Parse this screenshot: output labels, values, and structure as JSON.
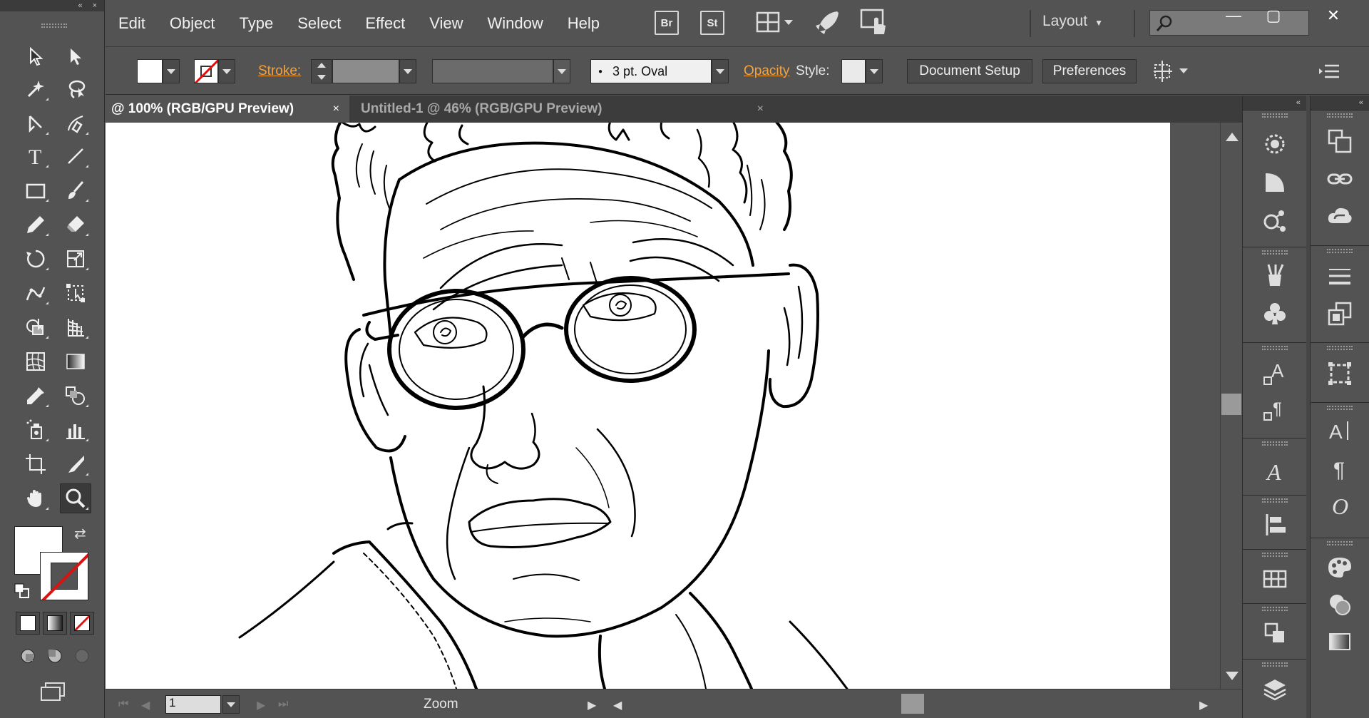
{
  "menubar": {
    "items": [
      "Edit",
      "Object",
      "Type",
      "Select",
      "Effect",
      "View",
      "Window",
      "Help"
    ],
    "bridge_label": "Br",
    "stock_label": "St",
    "workspace_label": "Layout",
    "search_placeholder": ""
  },
  "window_controls": {
    "minimize": "—",
    "maximize": "▢",
    "close": "✕"
  },
  "control_bar": {
    "stroke_label": "Stroke:",
    "brush_value": "3 pt. Oval",
    "opacity_label": "Opacity",
    "style_label": "Style:",
    "document_setup": "Document Setup",
    "preferences": "Preferences"
  },
  "tabs": [
    {
      "label": "@ 100% (RGB/GPU Preview)",
      "close": "×",
      "active": true
    },
    {
      "label": "Untitled-1 @ 46% (RGB/GPU Preview)",
      "close": "×",
      "active": false
    }
  ],
  "toolbox": {
    "header_collapse": "«",
    "header_close": "×",
    "tools": [
      "selection-tool",
      "direct-selection-tool",
      "magic-wand-tool",
      "lasso-tool",
      "pen-tool",
      "curvature-tool",
      "type-tool",
      "line-segment-tool",
      "rectangle-tool",
      "paintbrush-tool",
      "pencil-tool",
      "eraser-tool",
      "rotate-tool",
      "scale-tool",
      "puppet-warp-tool",
      "free-transform-tool",
      "shape-builder-tool",
      "perspective-grid-tool",
      "mesh-tool",
      "gradient-tool",
      "eyedropper-tool",
      "blend-tool",
      "symbol-sprayer-tool",
      "column-graph-tool",
      "artboard-tool",
      "slice-tool",
      "hand-tool",
      "zoom-tool"
    ],
    "active_tool": "zoom-tool"
  },
  "status_bar": {
    "page_number": "1",
    "status_text": "Zoom"
  },
  "panel_headers": {
    "dock1_collapse": "«",
    "dock2_collapse": "«"
  },
  "colors": {
    "ui_bg": "#535353",
    "ui_dark": "#3c3c3c",
    "accent_orange": "#f7a23a",
    "none_red": "#e01010",
    "canvas": "#ffffff"
  }
}
